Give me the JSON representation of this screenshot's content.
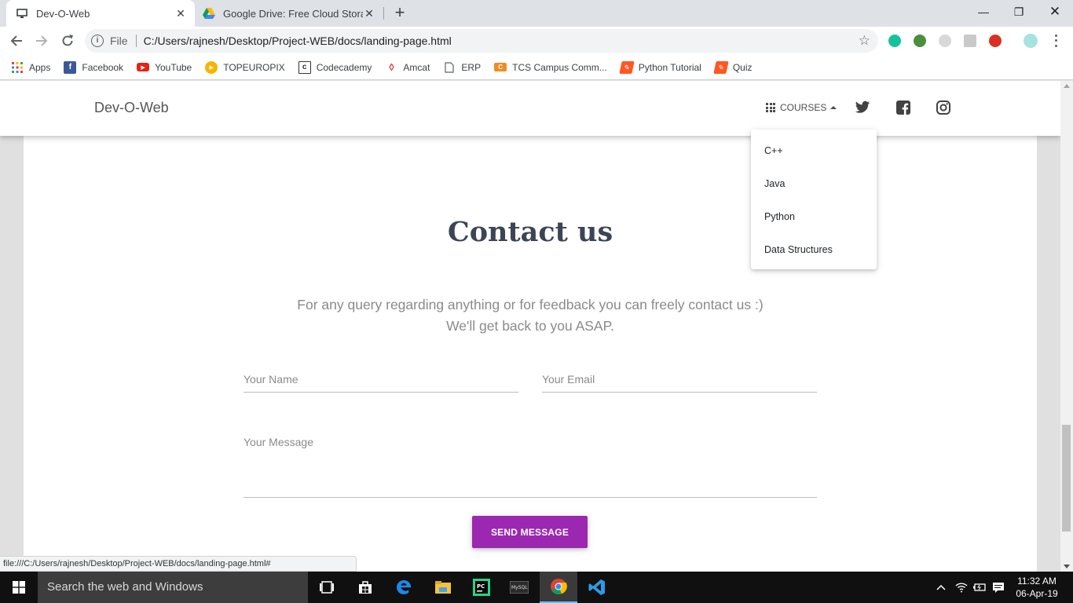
{
  "browser": {
    "tabs": [
      {
        "title": "Dev-O-Web",
        "close": "✕"
      },
      {
        "title": "Google Drive: Free Cloud Storage",
        "close": "✕"
      }
    ],
    "new_tab": "+",
    "window_controls": {
      "minimize": "—",
      "restore": "❐",
      "close": "✕"
    },
    "address": {
      "scheme": "File",
      "url": "C:/Users/rajnesh/Desktop/Project-WEB/docs/landing-page.html"
    },
    "bookmarks": [
      {
        "label": "Apps",
        "icon": "apps-grid-icon"
      },
      {
        "label": "Facebook",
        "icon": "facebook-icon"
      },
      {
        "label": "YouTube",
        "icon": "youtube-icon"
      },
      {
        "label": "TOPEUROPIX",
        "icon": "topeuropix-icon"
      },
      {
        "label": "Codecademy",
        "icon": "codecademy-icon"
      },
      {
        "label": "Amcat",
        "icon": "amcat-icon"
      },
      {
        "label": "ERP",
        "icon": "page-icon"
      },
      {
        "label": "TCS Campus Comm...",
        "icon": "tcs-icon"
      },
      {
        "label": "Python Tutorial",
        "icon": "python-tutorial-icon"
      },
      {
        "label": "Quiz",
        "icon": "quiz-icon"
      }
    ],
    "status_url": "file:///C:/Users/rajnesh/Desktop/Project-WEB/docs/landing-page.html#"
  },
  "site": {
    "brand": "Dev-O-Web",
    "nav": {
      "courses_label": "COURSES",
      "courses_items": [
        "C++",
        "Java",
        "Python",
        "Data Structures"
      ]
    },
    "contact": {
      "title": "Contact us",
      "subtitle_line1": "For any query regarding anything or for feedback you can freely contact us :)",
      "subtitle_line2": "We'll get back to you ASAP.",
      "name_placeholder": "Your Name",
      "email_placeholder": "Your Email",
      "message_placeholder": "Your Message",
      "submit_label": "SEND MESSAGE"
    },
    "accent_color": "#9c27b0"
  },
  "taskbar": {
    "search_placeholder": "Search the web and Windows",
    "time": "11:32 AM",
    "date": "06-Apr-19"
  }
}
